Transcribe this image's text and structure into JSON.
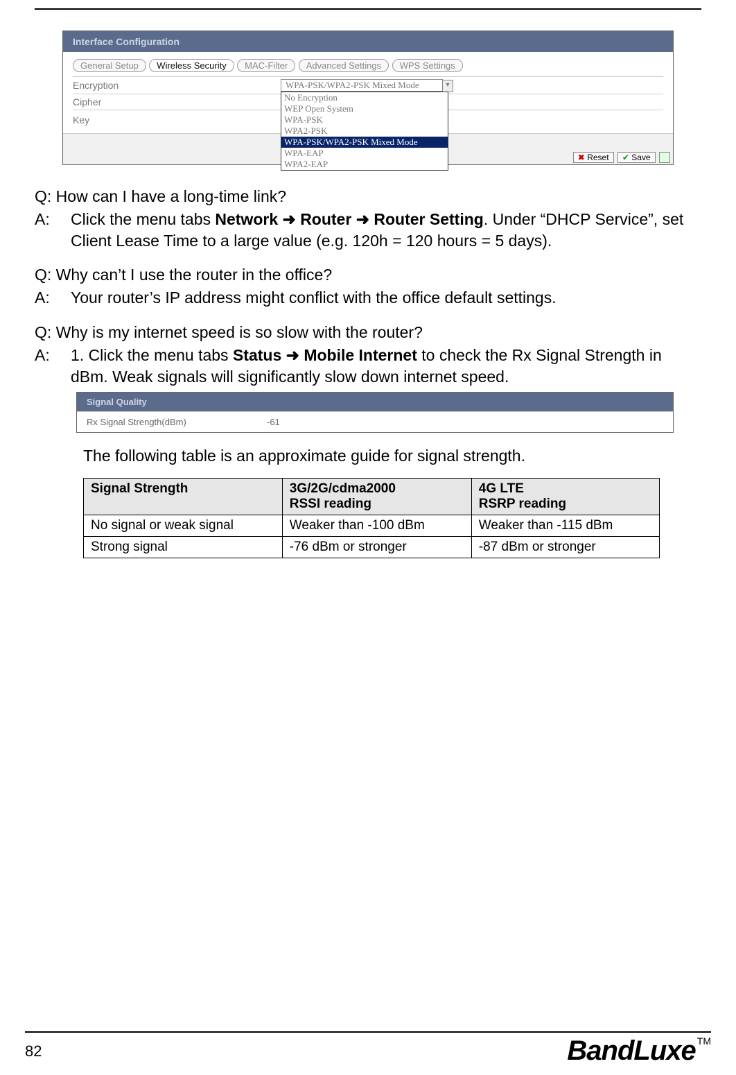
{
  "panel": {
    "title": "Interface Configuration",
    "tabs": [
      "General Setup",
      "Wireless Security",
      "MAC-Filter",
      "Advanced Settings",
      "WPS Settings"
    ],
    "active_tab_index": 1,
    "row_encryption_label": "Encryption",
    "row_encryption_value": "WPA-PSK/WPA2-PSK Mixed Mode",
    "row_cipher_label": "Cipher",
    "row_key_label": "Key",
    "dropdown_options": [
      "No Encryption",
      "WEP Open System",
      "WPA-PSK",
      "WPA2-PSK",
      "WPA-PSK/WPA2-PSK Mixed Mode",
      "WPA-EAP",
      "WPA2-EAP"
    ],
    "dropdown_selected_index": 4,
    "footer_reset": "Reset",
    "footer_save": "Save"
  },
  "qa1": {
    "q": "Q: How can I have a long-time link?",
    "a_prefix": "A:",
    "a_part1": "Click the menu tabs ",
    "a_bold1": "Network",
    "a_arrow": " ➜ ",
    "a_bold2": "Router",
    "a_bold3": "Router Setting",
    "a_part2": ". Under “DHCP Service”, set Client Lease Time to a large value (e.g. 120h = 120 hours = 5 days)."
  },
  "qa2": {
    "q": "Q: Why can’t I use the router in the office?",
    "a_prefix": "A:",
    "a": "Your router’s IP address might conflict with the office default settings."
  },
  "qa3": {
    "q": "Q: Why is my internet speed is so slow with the router?",
    "a_prefix": "A:",
    "a_part1": "1. Click the menu tabs ",
    "a_bold1": "Status",
    "a_arrow": " ➜ ",
    "a_bold2": "Mobile Internet",
    "a_part2": " to check the Rx Signal Strength in dBm. Weak signals will significantly slow down internet speed."
  },
  "sig_panel": {
    "title": "Signal Quality",
    "label": "Rx Signal Strength(dBm)",
    "value": "-61"
  },
  "guide_text": "The following table is an approximate guide for signal strength.",
  "strength_table": {
    "headers": [
      "Signal Strength",
      "3G/2G/cdma2000\nRSSI reading",
      "4G LTE\nRSRP reading"
    ],
    "rows": [
      [
        "No signal or weak signal",
        "Weaker than -100 dBm",
        "Weaker than -115 dBm"
      ],
      [
        "Strong signal",
        "-76 dBm or stronger",
        "-87 dBm or stronger"
      ]
    ]
  },
  "footer": {
    "page_num": "82",
    "brand": "BandLuxe",
    "tm": "TM"
  }
}
